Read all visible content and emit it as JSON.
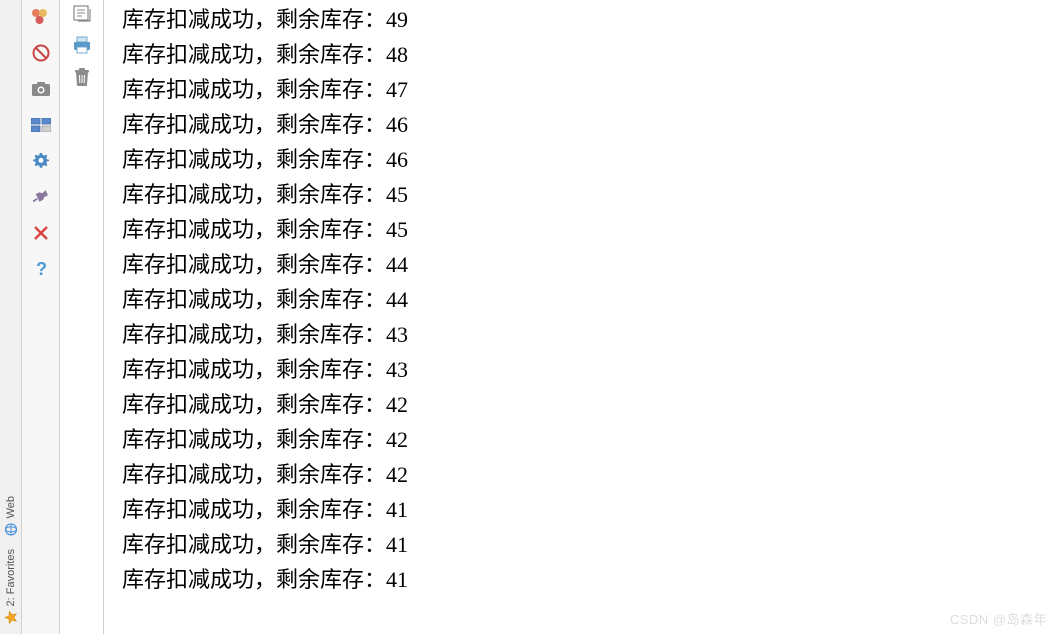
{
  "vertical_tabs": {
    "web": {
      "label": "Web"
    },
    "favorites": {
      "label": "2: Favorites"
    }
  },
  "toolbar": {
    "icons": [
      {
        "name": "breakpoints-icon"
      },
      {
        "name": "stop-icon"
      },
      {
        "name": "camera-icon"
      },
      {
        "name": "layout-icon"
      },
      {
        "name": "gear-icon"
      },
      {
        "name": "pin-icon"
      },
      {
        "name": "close-icon"
      },
      {
        "name": "help-icon"
      }
    ]
  },
  "secondary_toolbar": {
    "icons": [
      {
        "name": "scroll-icon"
      },
      {
        "name": "print-icon"
      },
      {
        "name": "trash-icon"
      }
    ]
  },
  "console": {
    "message_prefix": "库存扣减成功，剩余库存：",
    "values": [
      49,
      48,
      47,
      46,
      46,
      45,
      45,
      44,
      44,
      43,
      43,
      42,
      42,
      42,
      41,
      41,
      41
    ]
  },
  "watermark": "CSDN @岛森年"
}
